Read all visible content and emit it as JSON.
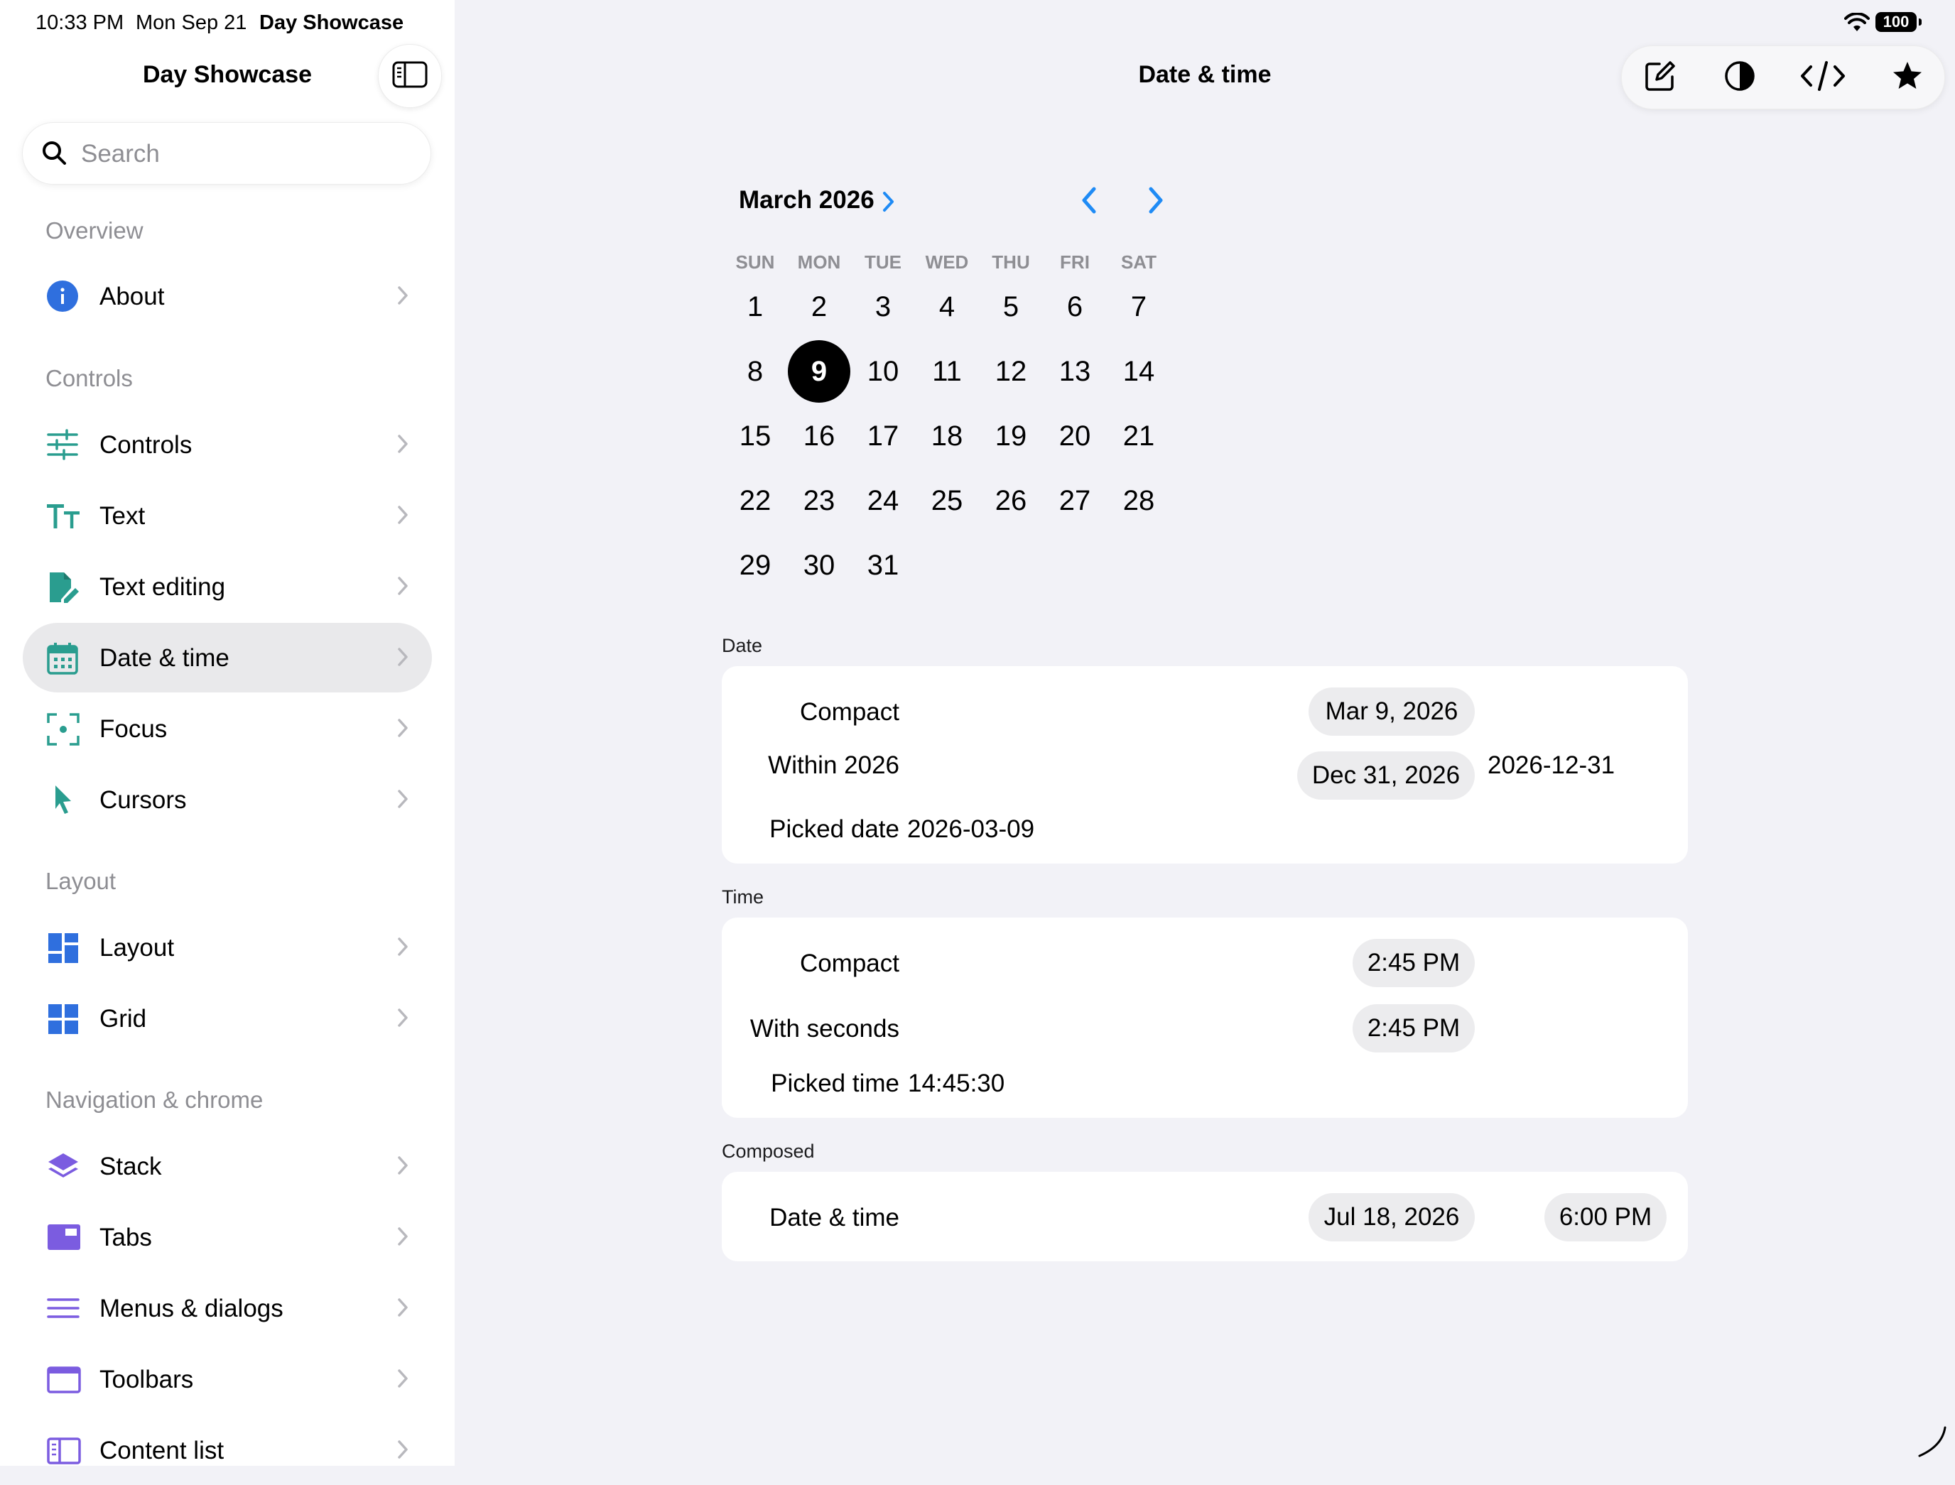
{
  "status_bar": {
    "time": "10:33 PM",
    "date": "Mon Sep 21",
    "app": "Day Showcase",
    "battery": "100"
  },
  "sidebar": {
    "title": "Day Showcase",
    "search_placeholder": "Search",
    "sections": [
      {
        "header": "Overview",
        "items": [
          {
            "label": "About",
            "icon": "info-icon"
          }
        ]
      },
      {
        "header": "Controls",
        "items": [
          {
            "label": "Controls",
            "icon": "sliders-icon"
          },
          {
            "label": "Text",
            "icon": "text-size-icon"
          },
          {
            "label": "Text editing",
            "icon": "document-edit-icon"
          },
          {
            "label": "Date & time",
            "icon": "calendar-icon",
            "selected": true
          },
          {
            "label": "Focus",
            "icon": "focus-icon"
          },
          {
            "label": "Cursors",
            "icon": "cursor-icon"
          }
        ]
      },
      {
        "header": "Layout",
        "items": [
          {
            "label": "Layout",
            "icon": "layout-icon"
          },
          {
            "label": "Grid",
            "icon": "grid-icon"
          }
        ]
      },
      {
        "header": "Navigation & chrome",
        "items": [
          {
            "label": "Stack",
            "icon": "stack-icon"
          },
          {
            "label": "Tabs",
            "icon": "tabs-icon"
          },
          {
            "label": "Menus & dialogs",
            "icon": "menu-icon"
          },
          {
            "label": "Toolbars",
            "icon": "toolbar-icon"
          },
          {
            "label": "Content list",
            "icon": "content-list-icon"
          }
        ]
      }
    ]
  },
  "main": {
    "title": "Date & time",
    "toolbar": [
      "compose-icon",
      "contrast-icon",
      "code-icon",
      "star-icon"
    ]
  },
  "calendar": {
    "month_label": "March 2026",
    "weekdays": [
      "SUN",
      "MON",
      "TUE",
      "WED",
      "THU",
      "FRI",
      "SAT"
    ],
    "days": [
      "1",
      "2",
      "3",
      "4",
      "5",
      "6",
      "7",
      "8",
      "9",
      "10",
      "11",
      "12",
      "13",
      "14",
      "15",
      "16",
      "17",
      "18",
      "19",
      "20",
      "21",
      "22",
      "23",
      "24",
      "25",
      "26",
      "27",
      "28",
      "29",
      "30",
      "31"
    ],
    "selected_day": "9"
  },
  "date_group": {
    "label": "Date",
    "compact_label": "Compact",
    "compact_value": "Mar 9, 2026",
    "within_label": "Within 2026",
    "within_value": "Dec 31, 2026",
    "within_iso": "2026-12-31",
    "picked_label": "Picked date",
    "picked_value": "2026-03-09"
  },
  "time_group": {
    "label": "Time",
    "compact_label": "Compact",
    "compact_value": "2:45 PM",
    "seconds_label": "With seconds",
    "seconds_value": "2:45 PM",
    "picked_label": "Picked time",
    "picked_value": "14:45:30"
  },
  "composed_group": {
    "label": "Composed",
    "datetime_label": "Date & time",
    "date_value": "Jul 18, 2026",
    "time_value": "6:00 PM"
  }
}
